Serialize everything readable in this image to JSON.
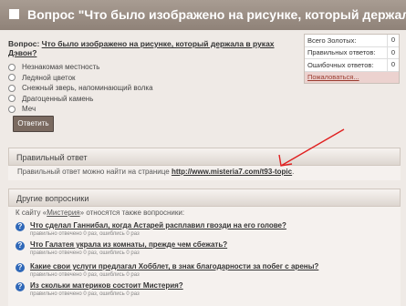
{
  "title": "Вопрос \"Что было изображено на рисунке, который держала в",
  "question": {
    "label": "Вопрос:",
    "text": "Что было изображено на рисунке, который держала в руках Дэвон?"
  },
  "options": [
    "Незнакомая местность",
    "Ледяной цветок",
    "Снежный зверь, напоминающий волка",
    "Драгоценный камень",
    "Меч"
  ],
  "answer_button": "Ответить",
  "stats": {
    "rows": [
      {
        "label": "Всего Золотых:",
        "value": "0"
      },
      {
        "label": "Правильных ответов:",
        "value": "0"
      },
      {
        "label": "Ошибочных ответов:",
        "value": "0"
      }
    ],
    "complain": "Пожаловаться..."
  },
  "correct_panel": {
    "title": "Правильный ответ",
    "text": "Правильный ответ можно найти на странице",
    "link": "http://www.misteria7.com/t93-topic",
    "period": "."
  },
  "others_panel": {
    "title": "Другие вопросники",
    "intro_prefix": "К сайту «",
    "intro_link": "Мистерия",
    "intro_suffix": "» относятся также вопросники:"
  },
  "other_questions": [
    {
      "title": "Что сделал Ганнибал, когда Астарей расплавил гвозди на его голове?",
      "stats": "правильно отвечено 0 раз, ошиблись 0 раз"
    },
    {
      "title": "Что Галатея украла из комнаты, прежде чем сбежать?",
      "stats": "правильно отвечено 0 раз, ошиблись 0 раз"
    },
    {
      "title": "Какие свои услуги предлагал Хобблет, в знак благодарности за побег с арены?",
      "stats": "правильно отвечено 0 раз, ошиблись 0 раз"
    },
    {
      "title": "Из скольки материков состоит Мистерия?",
      "stats": "правильно отвечено 0 раз, ошиблись 0 раз"
    }
  ]
}
